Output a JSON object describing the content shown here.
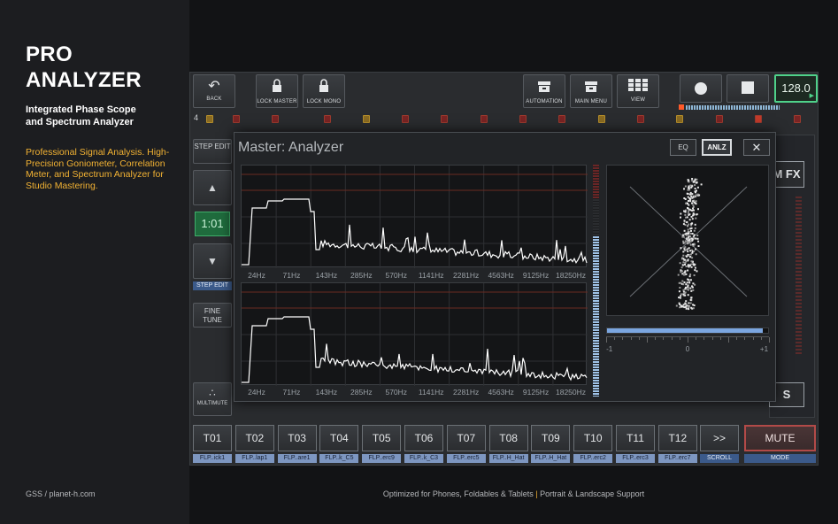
{
  "promo": {
    "brand_line1": "PRO",
    "brand_line2": "ANALYZER",
    "subtitle_line1": "Integrated Phase Scope",
    "subtitle_line2": "and Spectrum Analyzer",
    "description": "Professional Signal Analysis. High-Precision Goniometer, Correlation Meter, and Spectrum Analyzer for Studio Mastering.",
    "credit": "GSS / planet-h.com",
    "footer_left": "Optimized for Phones, Foldables & Tablets",
    "footer_sep": " | ",
    "footer_right": "Portrait & Landscape Support"
  },
  "toolbar": {
    "back": "BACK",
    "lock_master": "LOCK MASTER",
    "lock_mono": "LOCK MONO",
    "automation": "AUTOMATION",
    "main_menu": "MAIN MENU",
    "view": "VIEW",
    "bpm": "128.0"
  },
  "track_indicator": {
    "number": "4"
  },
  "sidebar": {
    "step_edit": "STEP EDIT",
    "counter": "1:01",
    "step_edit_label": "STEP EDIT",
    "fine_tune": "FINE TUNE",
    "multimute": "MULTIMUTE"
  },
  "right": {
    "mfx": "M FX",
    "s_btn": "S"
  },
  "tracks": [
    {
      "id": "T01",
      "name": "FLP..ick1"
    },
    {
      "id": "T02",
      "name": "FLP..lap1"
    },
    {
      "id": "T03",
      "name": "FLP..are1"
    },
    {
      "id": "T04",
      "name": "FLP..k_C5"
    },
    {
      "id": "T05",
      "name": "FLP..erc9"
    },
    {
      "id": "T06",
      "name": "FLP..k_C3"
    },
    {
      "id": "T07",
      "name": "FLP..erc5"
    },
    {
      "id": "T08",
      "name": "FLP..H_Hat"
    },
    {
      "id": "T09",
      "name": "FLP..H_Hat"
    },
    {
      "id": "T10",
      "name": "FLP..erc2"
    },
    {
      "id": "T11",
      "name": "FLP..erc3"
    },
    {
      "id": "T12",
      "name": "FLP..erc7"
    }
  ],
  "scroll": {
    "label": ">>",
    "caption": "SCROLL"
  },
  "mute": {
    "label": "MUTE",
    "caption": "MODE"
  },
  "analyzer": {
    "title": "Master: Analyzer",
    "eq": "EQ",
    "anlz": "ANLZ",
    "close": "✕",
    "freq_labels": [
      "24Hz",
      "71Hz",
      "143Hz",
      "285Hz",
      "570Hz",
      "1141Hz",
      "2281Hz",
      "4563Hz",
      "9125Hz",
      "18250Hz"
    ],
    "correlation": {
      "min": "-1",
      "mid": "0",
      "max": "+1",
      "value": 0.93
    },
    "level_meter_fraction": 0.69
  },
  "icons": {
    "back": "back-arrow-icon",
    "lock": "lock-icon",
    "automation": "automation-icon",
    "main_menu": "main-menu-icon",
    "view": "grid-view-icon",
    "record": "record-icon",
    "stop": "stop-icon",
    "play": "play-icon",
    "multimute": "multimute-icon"
  },
  "colors": {
    "accent_orange": "#f2b233",
    "bpm_green": "#4fd28a",
    "mute_red": "#b24a48",
    "label_blue": "#3b5a8a",
    "spectrum_line": "#ffffff"
  }
}
